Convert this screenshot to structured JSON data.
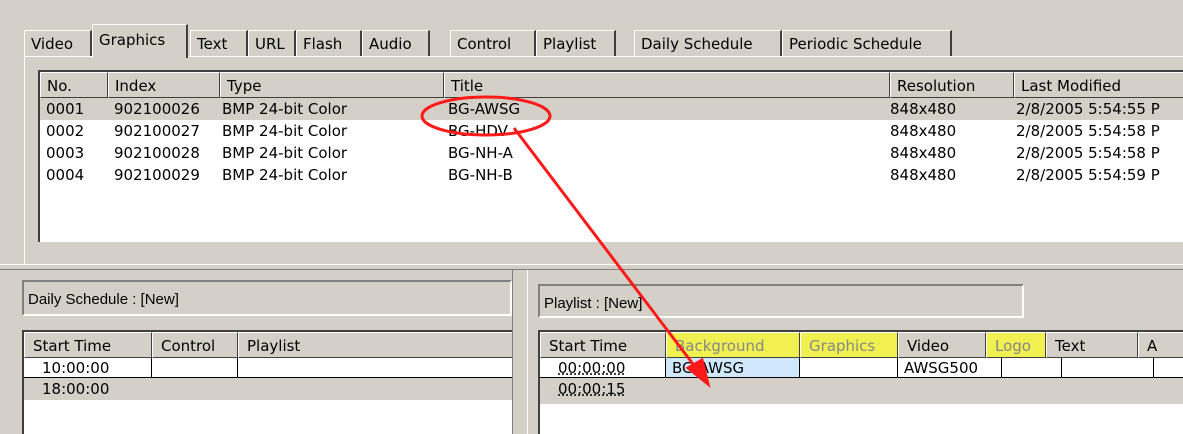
{
  "tabs": [
    {
      "label": "Video"
    },
    {
      "label": "Graphics"
    },
    {
      "label": "Text"
    },
    {
      "label": "URL"
    },
    {
      "label": "Flash"
    },
    {
      "label": "Audio"
    },
    {
      "label": "Control"
    },
    {
      "label": "Playlist"
    },
    {
      "label": "Daily Schedule"
    },
    {
      "label": "Periodic Schedule"
    }
  ],
  "graphics_list": {
    "columns": [
      "No.",
      "Index",
      "Type",
      "Title",
      "Resolution",
      "Last Modified"
    ],
    "rows": [
      {
        "no": "0001",
        "index": "902100026",
        "type": "BMP 24-bit Color",
        "title": "BG-AWSG",
        "resolution": "848x480",
        "modified": "2/8/2005 5:54:55 P"
      },
      {
        "no": "0002",
        "index": "902100027",
        "type": "BMP 24-bit Color",
        "title": "BG-HDV",
        "resolution": "848x480",
        "modified": "2/8/2005 5:54:58 P"
      },
      {
        "no": "0003",
        "index": "902100028",
        "type": "BMP 24-bit Color",
        "title": "BG-NH-A",
        "resolution": "848x480",
        "modified": "2/8/2005 5:54:58 P"
      },
      {
        "no": "0004",
        "index": "902100029",
        "type": "BMP 24-bit Color",
        "title": "BG-NH-B",
        "resolution": "848x480",
        "modified": "2/8/2005 5:54:59 P"
      }
    ]
  },
  "daily_schedule": {
    "title": "Daily Schedule : [New]",
    "columns": [
      "Start Time",
      "Control",
      "Playlist"
    ],
    "rows": [
      {
        "start": "10:00:00",
        "control": "",
        "playlist": ""
      },
      {
        "start": "18:00:00",
        "control": "",
        "playlist": ""
      }
    ]
  },
  "playlist": {
    "title": "Playlist : [New]",
    "columns": [
      "Start Time",
      "Background",
      "Graphics",
      "Video",
      "Logo",
      "Text",
      "A"
    ],
    "rows": [
      {
        "start": "00:00:00",
        "background": "BG-AWSG",
        "graphics": "",
        "video": "AWSG500",
        "logo": "",
        "text": ""
      },
      {
        "start": "00:00:15"
      }
    ]
  },
  "colors": {
    "window_bg": "#d4d0c8",
    "highlight_header": "#f0f050",
    "selected_cell": "#cfe8fb",
    "annotation": "#ff1a1a"
  }
}
